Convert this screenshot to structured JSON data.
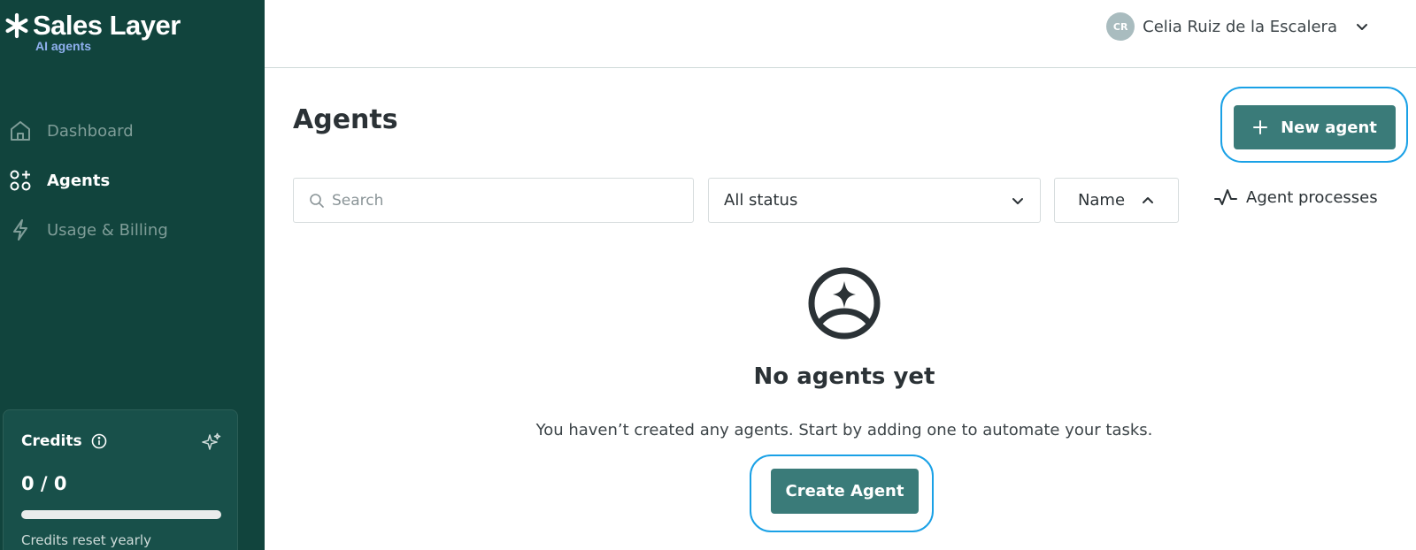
{
  "brand": {
    "name": "Sales Layer",
    "subtitle": "AI agents"
  },
  "sidebar": {
    "items": [
      {
        "label": "Dashboard",
        "icon": "home-icon",
        "active": false
      },
      {
        "label": "Agents",
        "icon": "agents-icon",
        "active": true
      },
      {
        "label": "Usage & Billing",
        "icon": "lightning-icon",
        "active": false
      }
    ]
  },
  "credits": {
    "title": "Credits",
    "value": "0 / 0",
    "used_fraction": 0,
    "note": "Credits reset yearly"
  },
  "user": {
    "initials": "CR",
    "name": "Celia Ruiz de la Escalera"
  },
  "main": {
    "title": "Agents",
    "new_agent_label": "New agent",
    "search_placeholder": "Search",
    "status_filter": "All status",
    "sort_label": "Name",
    "processes_label": "Agent processes",
    "empty_title": "No agents yet",
    "empty_description": "You haven’t created any agents. Start by adding one to automate your tasks.",
    "create_label": "Create Agent"
  },
  "colors": {
    "sidebar_bg": "#11443d",
    "primary_button": "#3a7b79",
    "highlight_outline": "#1aa1e6",
    "logo_subtitle": "#8fb0ef"
  }
}
